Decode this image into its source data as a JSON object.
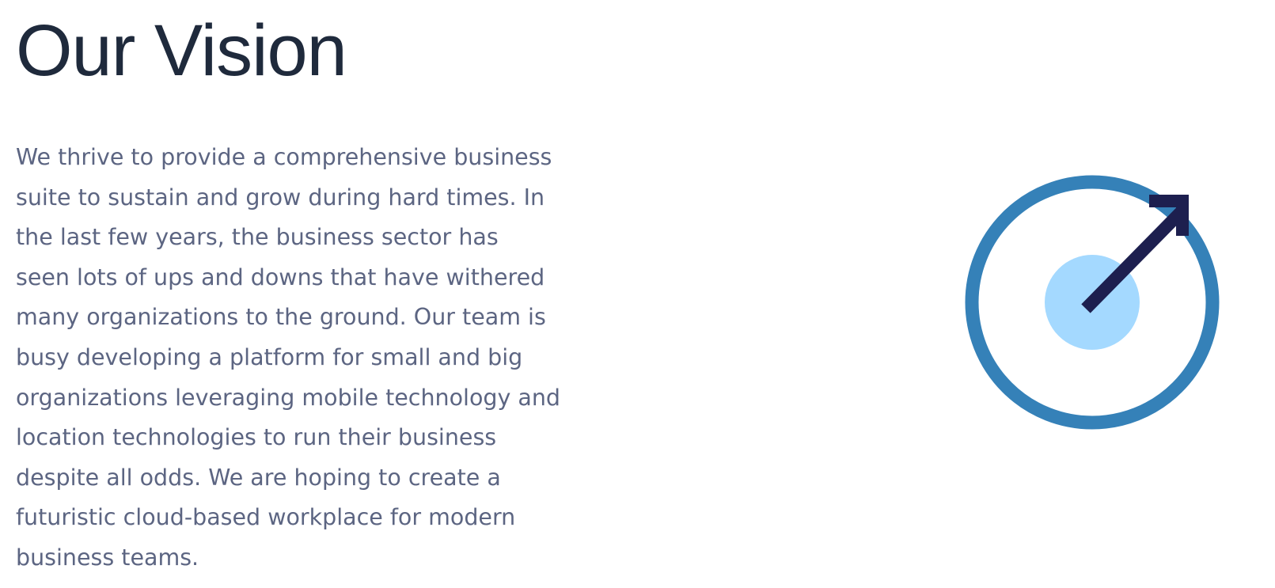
{
  "section": {
    "title": "Our Vision",
    "paragraph_lines": [
      "We thrive to provide a comprehensive business",
      "suite to sustain and grow during hard times. In",
      "the last few years, the business sector has",
      "seen lots of ups and downs that have withered",
      "many organizations to the ground. Our team is",
      "busy developing a platform for small and big",
      "organizations leveraging mobile technology and",
      "location technologies to run their business",
      "despite all odds. We are hoping to create a",
      "futuristic cloud-based workplace for modern",
      "business teams."
    ]
  },
  "illustration": {
    "icon": "target-arrow-icon",
    "colors": {
      "ring": "#3581b8",
      "center": "#a4d9ff",
      "arrow": "#1d1f4f"
    }
  }
}
